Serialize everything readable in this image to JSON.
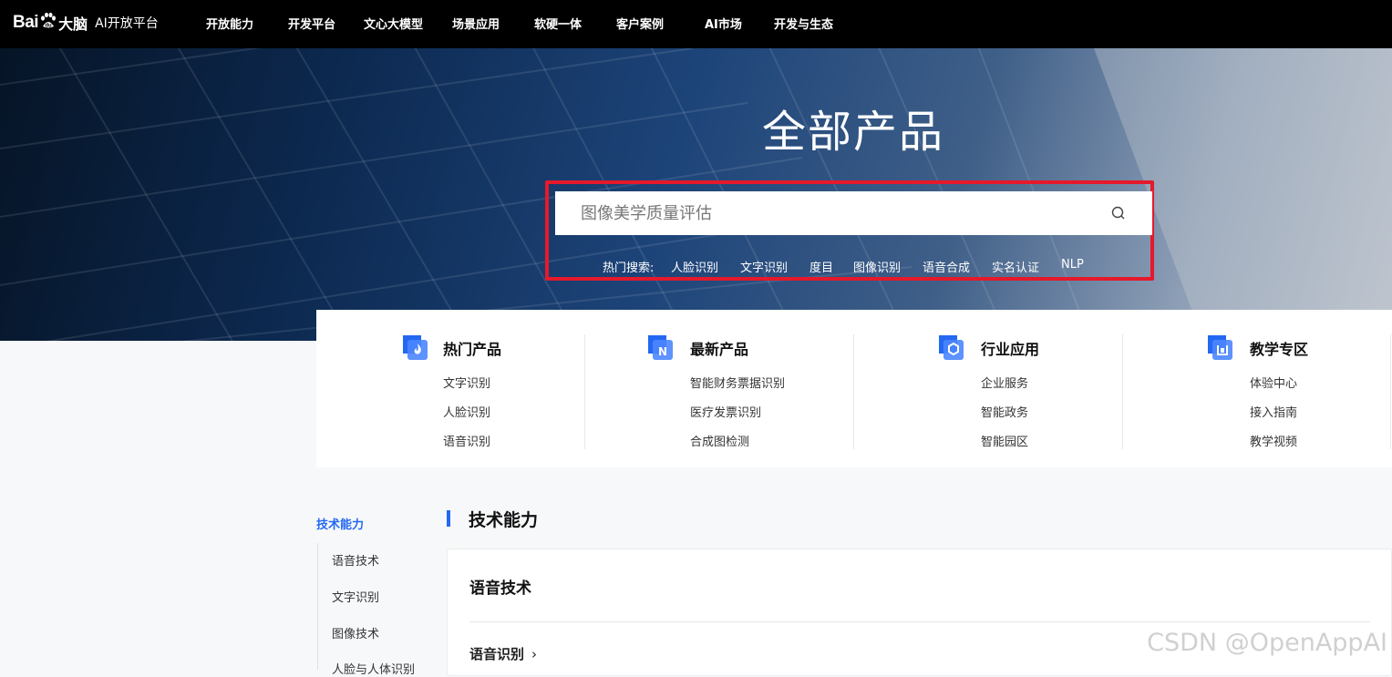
{
  "header": {
    "logo": {
      "brand": "Bai",
      "brand_suffix": "大脑",
      "platform": "AI开放平台"
    },
    "nav": [
      "开放能力",
      "开发平台",
      "文心大模型",
      "场景应用",
      "软硬一体",
      "客户案例",
      "AI市场",
      "开发与生态"
    ]
  },
  "hero": {
    "title": "全部产品",
    "search": {
      "placeholder": "图像美学质量评估"
    },
    "hot_label": "热门搜索:",
    "hot_links": [
      "人脸识别",
      "文字识别",
      "度目",
      "图像识别",
      "语音合成",
      "实名认证",
      "NLP"
    ],
    "highlight_color": "#e5192b"
  },
  "categories": [
    {
      "title": "热门产品",
      "icon": "flame-icon",
      "links": [
        "文字识别",
        "人脸识别",
        "语音识别"
      ]
    },
    {
      "title": "最新产品",
      "icon": "new-icon",
      "links": [
        "智能财务票据识别",
        "医疗发票识别",
        "合成图检测"
      ]
    },
    {
      "title": "行业应用",
      "icon": "hexagon-icon",
      "links": [
        "企业服务",
        "智能政务",
        "智能园区"
      ]
    },
    {
      "title": "教学专区",
      "icon": "book-icon",
      "links": [
        "体验中心",
        "接入指南",
        "教学视频"
      ]
    }
  ],
  "sidebar": {
    "active": "技术能力",
    "items": [
      "语音技术",
      "文字识别",
      "图像技术",
      "人脸与人体识别"
    ]
  },
  "main": {
    "section_title": "技术能力",
    "card": {
      "title": "语音技术",
      "sub_link": "语音识别",
      "chevron": "›"
    }
  },
  "watermark": "CSDN @OpenAppAI",
  "colors": {
    "accent": "#2468f2",
    "nav_bg": "#000000"
  }
}
